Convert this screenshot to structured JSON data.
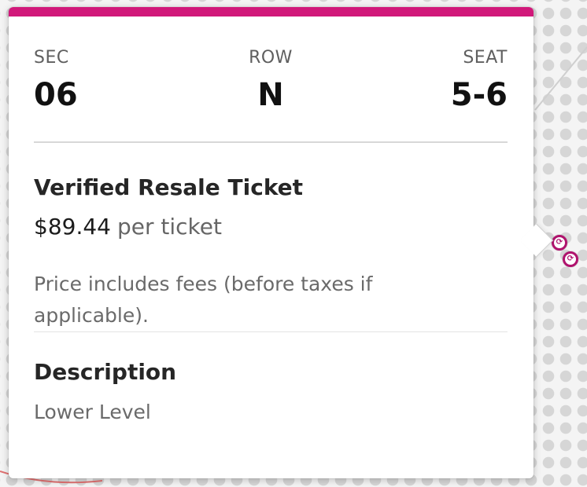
{
  "seat_info": {
    "section_label": "SEC",
    "section_value": "06",
    "row_label": "ROW",
    "row_value": "N",
    "seat_label": "SEAT",
    "seat_value": "5-6"
  },
  "ticket": {
    "type": "Verified Resale Ticket",
    "price": "$89.44",
    "price_unit": "per ticket",
    "price_note": "Price includes fees (before taxes if applicable)."
  },
  "description": {
    "heading": "Description",
    "text": "Lower Level"
  },
  "icons": {
    "seat_marker": "resale-seat-marker-icon"
  },
  "colors": {
    "accent": "#d1187a",
    "marker": "#b0126d"
  }
}
